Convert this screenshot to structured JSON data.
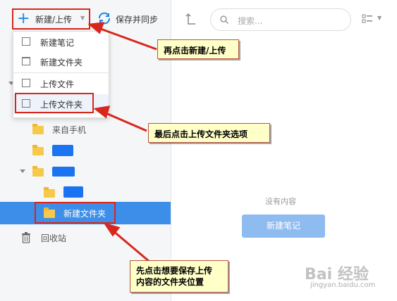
{
  "toolbar": {
    "new_upload_label": "新建/上传",
    "save_sync_label": "保存并同步"
  },
  "dropdown": {
    "items": [
      {
        "label": "新建笔记"
      },
      {
        "label": "新建文件夹"
      },
      {
        "label": "上传文件"
      },
      {
        "label": "上传文件夹"
      }
    ]
  },
  "tree": {
    "from_phone": "来自手机",
    "selected_folder": "新建文件夹",
    "recycle_bin": "回收站"
  },
  "search": {
    "placeholder": "搜索..."
  },
  "main": {
    "empty_text": "没有内容",
    "new_note_button": "新建笔记"
  },
  "callouts": {
    "step1": "先点击想要保存上传\n内容的文件夹位置",
    "step2": "再点击新建/上传",
    "step3": "最后点击上传文件夹选项"
  },
  "watermark": {
    "brand": "Bai 经验",
    "url": "jingyan.baidu.com"
  },
  "colors": {
    "accent": "#1e88e5",
    "selected_row": "#3d8ee8",
    "callout_bg": "#ffffc8",
    "annotation_red": "#d8261d"
  }
}
